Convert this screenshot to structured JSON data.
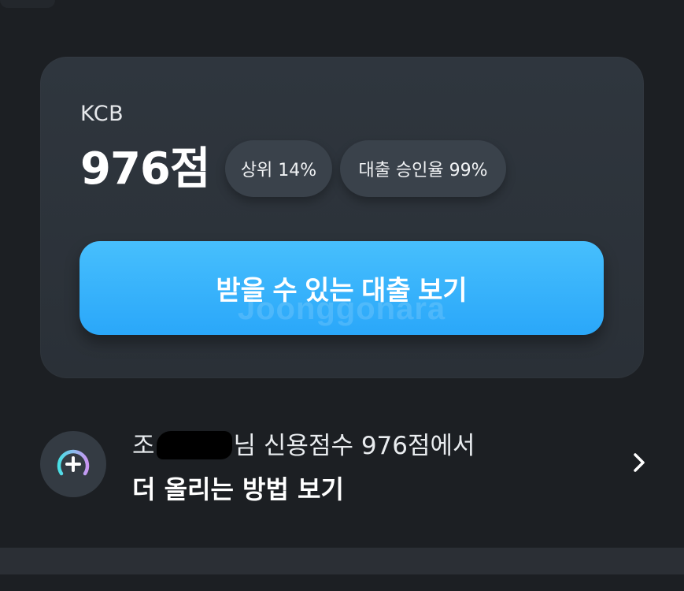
{
  "credit_card": {
    "bureau": "KCB",
    "score": "976점",
    "rank_badge": "상위 14%",
    "approval_badge": "대출 승인율 99%",
    "cta_label": "받을 수 있는 대출 보기",
    "watermark": "Joonggonara"
  },
  "tip": {
    "line1_prefix": "조",
    "line1_suffix": "님 신용점수 976점에서",
    "line2": "더 올리는 방법 보기",
    "icon": "score-boost-plus-icon"
  },
  "colors": {
    "background": "#1c1f23",
    "card": "#2f363e",
    "chip": "#3a424b",
    "cta": "#34b1fb",
    "gauge_start": "#49e0e6",
    "gauge_end": "#c996f2"
  }
}
